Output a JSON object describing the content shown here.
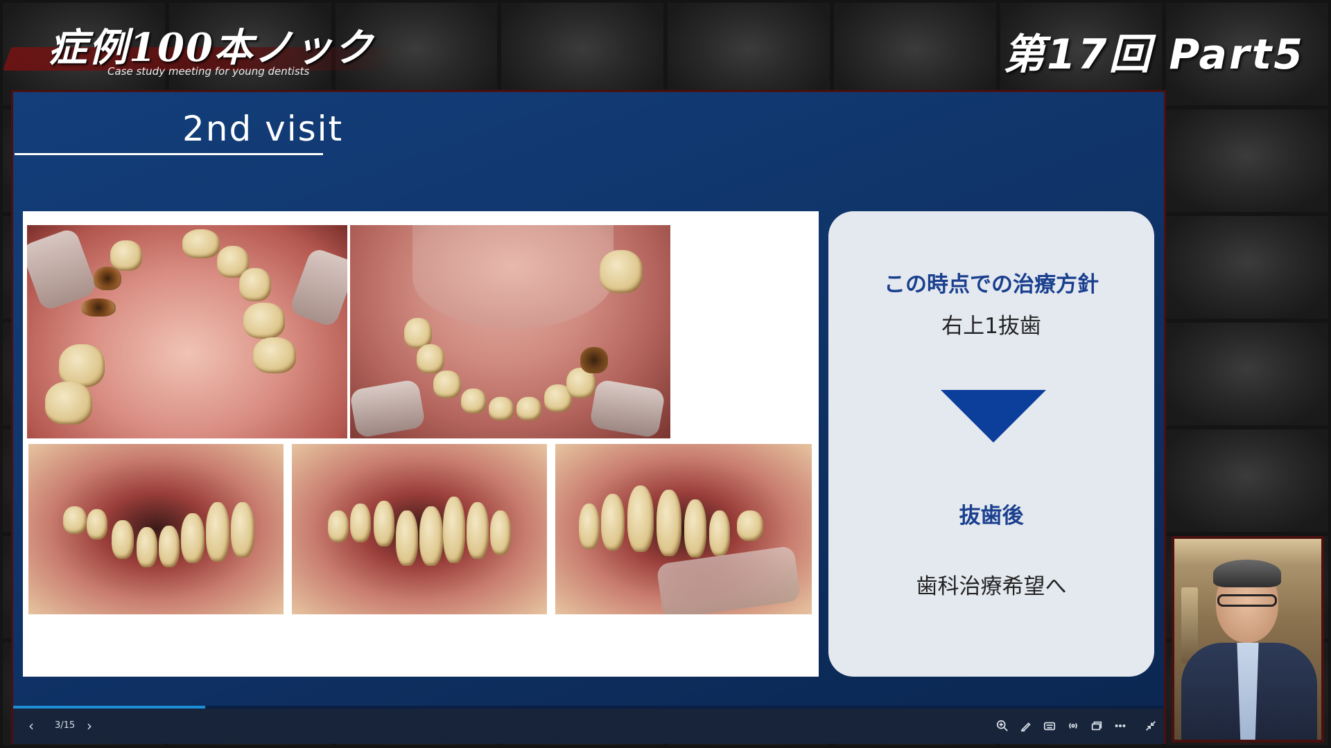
{
  "header": {
    "logo_title": "症例100本ノック",
    "logo_subtitle": "Case study meeting for young dentists",
    "episode": "第17回 Part5"
  },
  "slide": {
    "title": "2nd visit",
    "policy_heading": "この時点での治療方針",
    "policy_value": "右上1抜歯",
    "after_heading": "抜歯後",
    "after_value": "歯科治療希望へ"
  },
  "controls": {
    "page_indicator": "3/15",
    "progress_fraction": 0.167
  },
  "colors": {
    "slide_bg": "#133e7a",
    "accent_blue": "#1a3f8f",
    "arrow": "#0c3f9b",
    "frame": "#4a1010",
    "progress": "#1e8fd6"
  },
  "icons": [
    "chevron-left-icon",
    "chevron-right-icon",
    "zoom-icon",
    "pen-icon",
    "keyboard-icon",
    "broadcast-icon",
    "window-icon",
    "more-icon",
    "collapse-icon"
  ]
}
